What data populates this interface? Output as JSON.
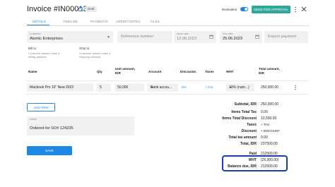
{
  "header": {
    "title": "Invoice #IN00013",
    "status": "Draft",
    "reminders_label": "Reminders",
    "send_label": "SEND FOR APPROVAL"
  },
  "tabs": [
    {
      "label": "DETAILS",
      "active": true
    },
    {
      "label": "TIMELINE"
    },
    {
      "label": "PAYMENTS"
    },
    {
      "label": "CREDIT NOTES"
    },
    {
      "label": "FILES"
    }
  ],
  "form": {
    "customer_label": "Customer",
    "customer_value": "Atomic Enterprises",
    "reference_placeholder": "Reference number",
    "issue_label": "Issue date",
    "issue_value": "12.06.2023",
    "due_label": "Due date",
    "due_value": "25.06.2023",
    "expect_placeholder": "Expect payment",
    "bill_to_label": "Bill to",
    "bill_to_text": "Customer doesn't have a billing address",
    "ship_to_label": "Ship to",
    "ship_to_text": "Customer doesn't have a shipping address"
  },
  "table": {
    "headers": {
      "name": "Name",
      "qty": "Qty",
      "unit_amount": "Unit amount, IDR",
      "account": "Account",
      "discounts": "Discounts",
      "taxes": "Taxes",
      "wht": "WHT",
      "total_amount": "Total amount, IDR"
    },
    "rows": [
      {
        "name": "Macbook Pro 16\" New 2023",
        "qty": "5",
        "unit_amount": "50,000",
        "account": "Bank accou...",
        "discount": "5%",
        "tax": "+ TAX",
        "wht": "10% (nam...)",
        "total": "250,000.00"
      }
    ],
    "add_item_label": "ADD ITEM"
  },
  "notes": {
    "label": "Notes",
    "value": "Ordered for SO# 124235"
  },
  "save_label": "SAVE",
  "totals": {
    "subtotal_label": "Subtotal, IDR",
    "subtotal_value": "250,000.00",
    "items_total_tax_label": "Items Total Tax",
    "items_total_tax_value": "0.00",
    "items_total_discount_label": "Items Total Discount",
    "items_total_discount_value": "12,500.00",
    "taxes_label": "Taxes",
    "taxes_value": "+ TAX",
    "discount_label": "Discount",
    "discount_value": "+ DISCOUNT",
    "total_tax_amount_label": "Total tax amount",
    "total_tax_amount_value": "0.00",
    "total_label": "Total, IDR",
    "total_value": "237500.00",
    "paid_label": "Paid",
    "paid_value": "212500.00",
    "wht_label": "WHT",
    "wht_value": "(25,000.00)",
    "balance_label": "Balance due, IDR",
    "balance_value": "212500.00"
  },
  "colors": {
    "accent": "#1e88e5",
    "send_button": "#2ea79a",
    "highlight_box": "#1f3fa8"
  }
}
